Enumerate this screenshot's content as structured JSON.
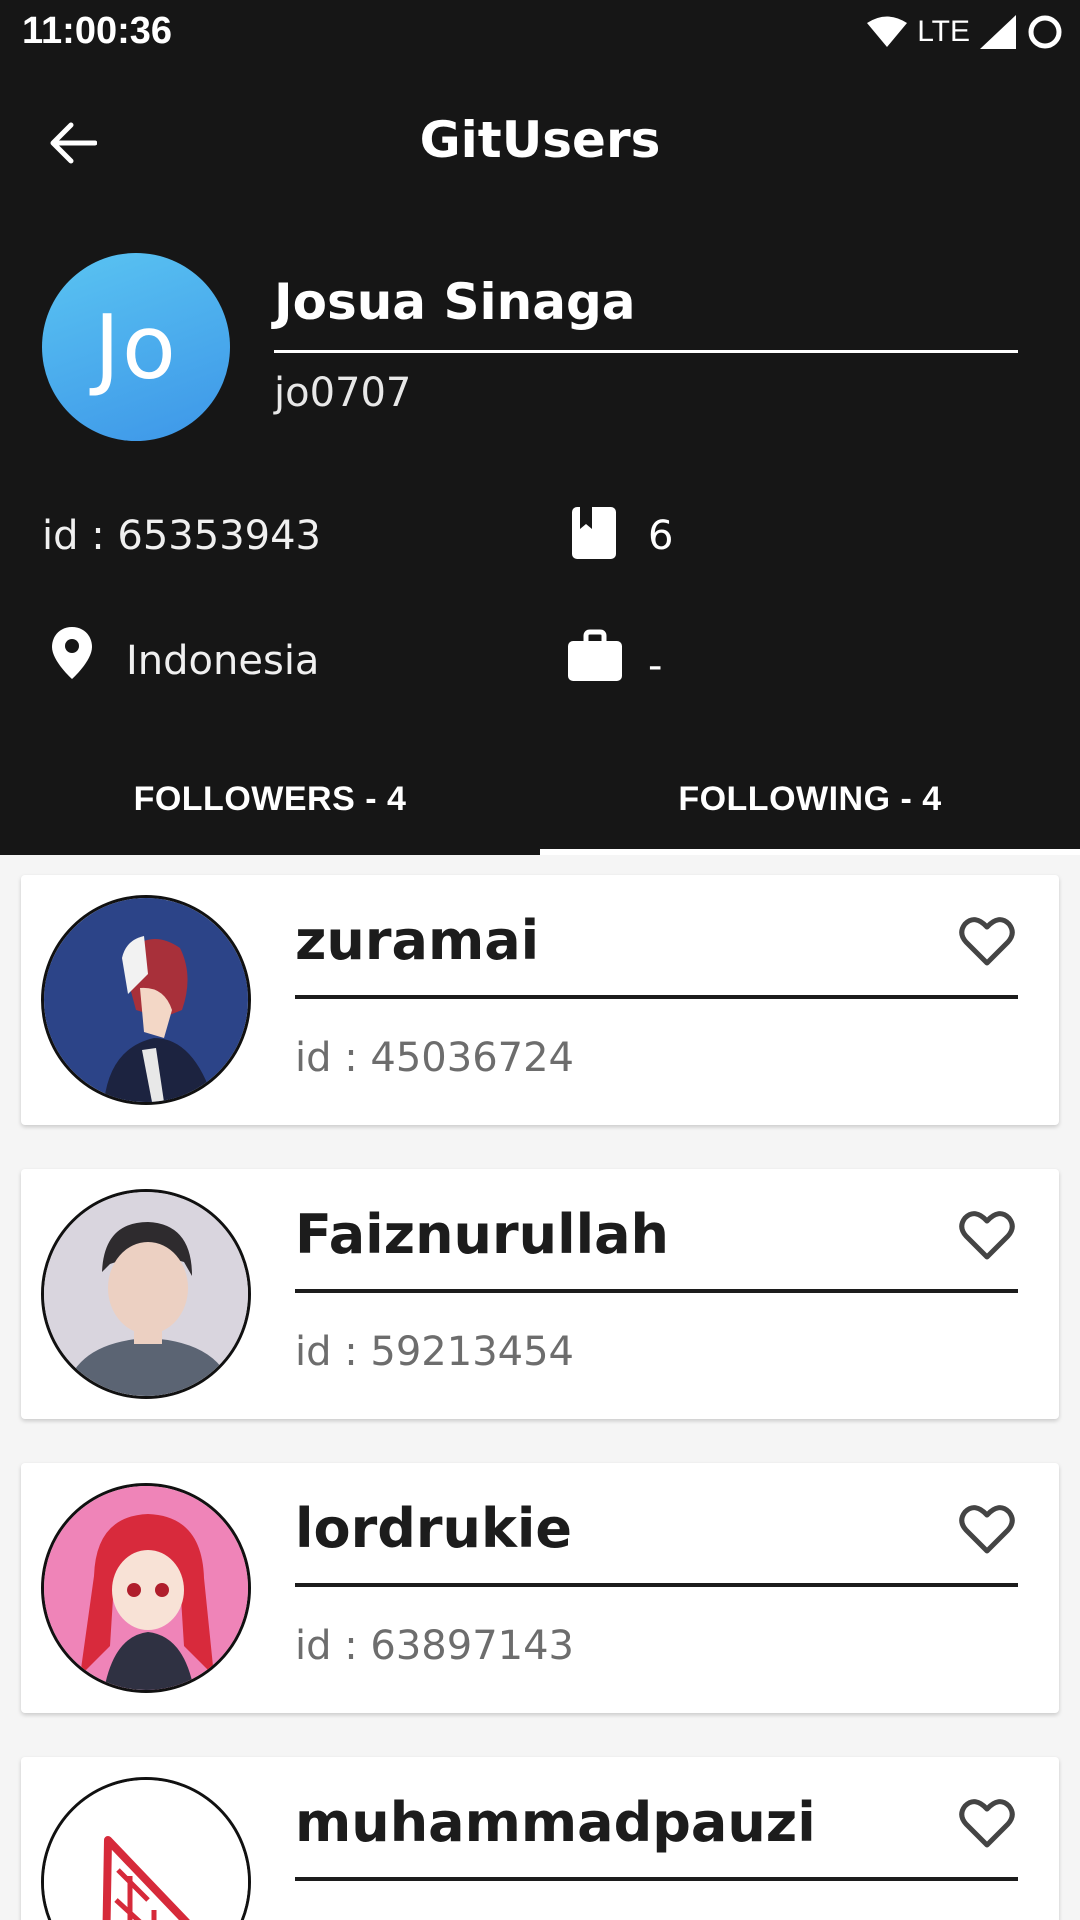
{
  "status_bar": {
    "time": "11:00:36",
    "network": "LTE"
  },
  "header": {
    "title": "GitUsers"
  },
  "profile": {
    "initials": "Jo",
    "name": "Josua Sinaga",
    "login": "jo0707",
    "id_text": "id : 65353943",
    "repos": "6",
    "location": "Indonesia",
    "company": "-"
  },
  "tabs": [
    {
      "label": "FOLLOWERS - 4",
      "selected": false
    },
    {
      "label": "FOLLOWING - 4",
      "selected": true
    }
  ],
  "users": [
    {
      "name": "zuramai",
      "id_text": "id : 45036724"
    },
    {
      "name": "Faiznurullah",
      "id_text": "id : 59213454"
    },
    {
      "name": "lordrukie",
      "id_text": "id : 63897143"
    },
    {
      "name": "muhammadpauzi",
      "id_text": ""
    }
  ],
  "icons": {
    "back": "arrow-left-icon",
    "repo": "book-icon",
    "location": "pin-icon",
    "company": "briefcase-icon",
    "favorite": "heart-outline-icon"
  },
  "colors": {
    "background_dark": "#161616",
    "surface": "#ffffff",
    "avatar_gradient_start": "#5ac4f2",
    "avatar_gradient_end": "#3d96e8"
  }
}
